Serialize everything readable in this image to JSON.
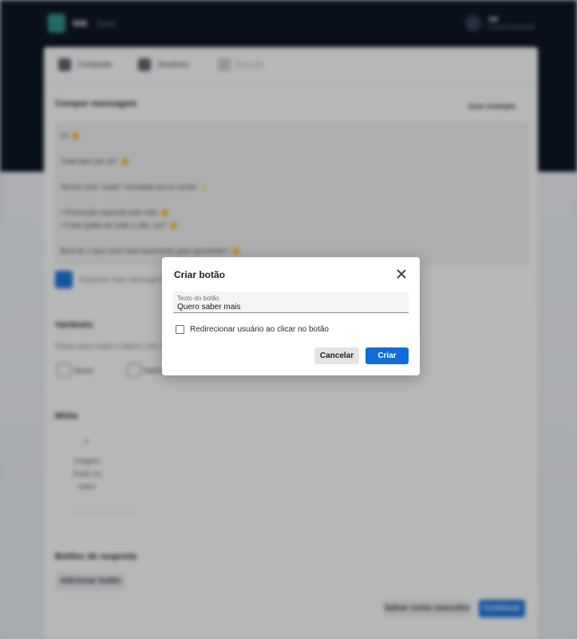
{
  "background": {
    "brand": "WB",
    "brand_sub": "Sonia",
    "user_name": "SM",
    "user_meta": "Conta Empresarial",
    "steps": [
      "Conteúdo",
      "Destinos",
      "Revisão"
    ],
    "section_compose": "Compor mensagem",
    "link_example": "Usar exemplo",
    "editor_lines": [
      "Oi",
      "Tudo bem por aí?",
      "Temos uma \"super\" novidade pra te contar ✨",
      "• Promoção especial este mês",
      "• Frete grátis em todo o site, viu?",
      "Bora lá, o que você está esperando para aproveitar?"
    ],
    "editor_hint": "Adicionar mais mensagens",
    "section_variables": "Variáveis",
    "variables_desc": "Clique para copiar e depois cole no texto",
    "chip_1": "Nome",
    "chip_2": "Telefone",
    "section_media": "Mídia",
    "upload_text": "Imagem Áudio ou vídeo",
    "section_buttons": "Botões de resposta",
    "add_button": "Adicionar botão",
    "save_draft": "Salvar como rascunho",
    "continue": "Continuar"
  },
  "modal": {
    "title": "Criar botão",
    "field_label": "Texto do botão",
    "field_value": "Quero saber mais",
    "checkbox_label": "Redirecionar usuário ao clicar no botão",
    "checkbox_checked": false,
    "cancel_label": "Cancelar",
    "create_label": "Criar"
  },
  "colors": {
    "primary": "#0f6cd8",
    "header_dark": "#0d1626",
    "overlay": "rgba(0,0,0,0.25)"
  }
}
